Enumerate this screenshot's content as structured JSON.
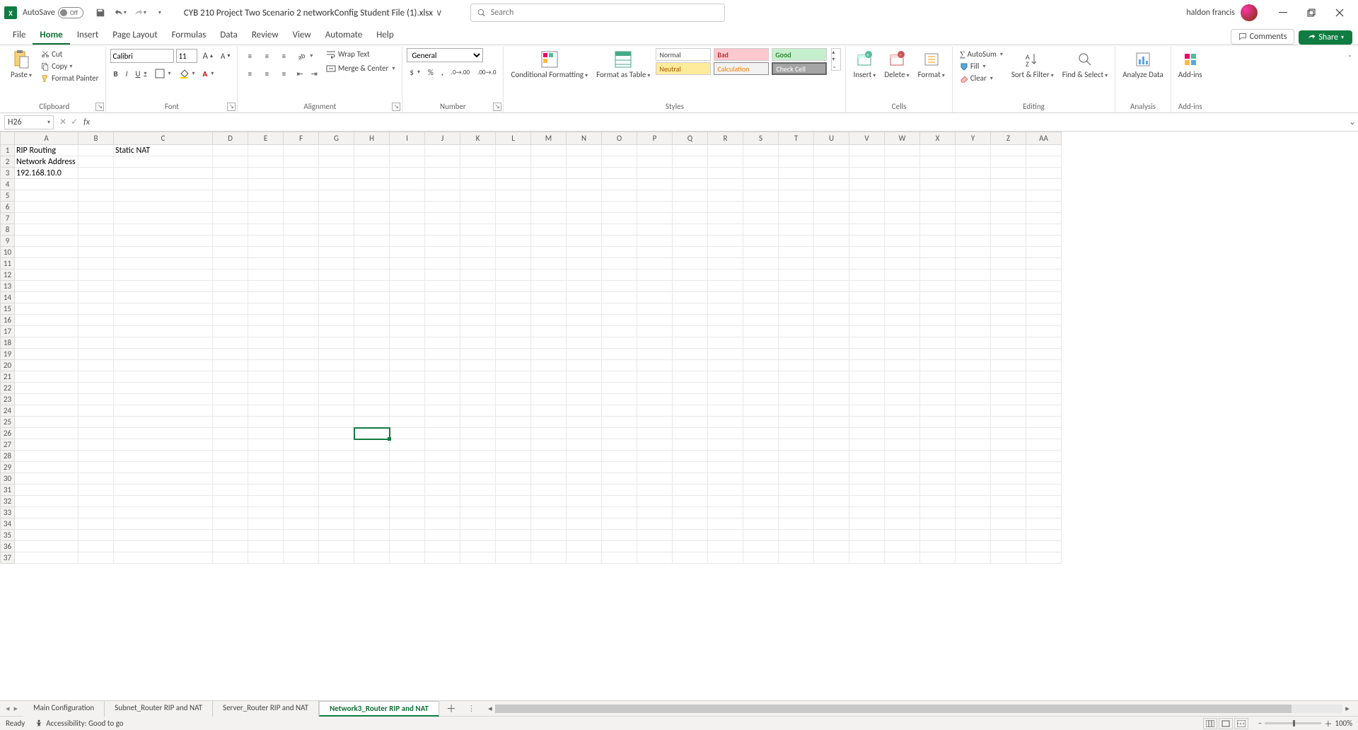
{
  "titlebar": {
    "autosave_label": "AutoSave",
    "autosave_state": "Off",
    "filename": "CYB 210 Project Two Scenario 2 networkConfig Student File (1).xlsx",
    "search_placeholder": "Search",
    "user": "haldon francis"
  },
  "tabs": {
    "items": [
      "File",
      "Home",
      "Insert",
      "Page Layout",
      "Formulas",
      "Data",
      "Review",
      "View",
      "Automate",
      "Help"
    ],
    "active": "Home",
    "comments": "Comments",
    "share": "Share"
  },
  "ribbon": {
    "clipboard": {
      "paste": "Paste",
      "cut": "Cut",
      "copy": "Copy",
      "painter": "Format Painter",
      "label": "Clipboard"
    },
    "font": {
      "name": "Calibri",
      "size": "11",
      "label": "Font"
    },
    "alignment": {
      "wrap": "Wrap Text",
      "merge": "Merge & Center",
      "label": "Alignment"
    },
    "number": {
      "format": "General",
      "label": "Number"
    },
    "styles": {
      "cond": "Conditional Formatting",
      "table": "Format as Table",
      "normal": "Normal",
      "bad": "Bad",
      "good": "Good",
      "neutral": "Neutral",
      "calc": "Calculation",
      "check": "Check Cell",
      "label": "Styles"
    },
    "cells": {
      "insert": "Insert",
      "delete": "Delete",
      "format": "Format",
      "label": "Cells"
    },
    "editing": {
      "autosum": "AutoSum",
      "fill": "Fill",
      "clear": "Clear",
      "sort": "Sort & Filter",
      "find": "Find & Select",
      "label": "Editing"
    },
    "analysis": {
      "analyze": "Analyze Data",
      "label": "Analysis"
    },
    "addins": {
      "addins": "Add-ins",
      "label": "Add-ins"
    }
  },
  "fbar": {
    "namebox": "H26",
    "formula": ""
  },
  "grid": {
    "cols": [
      "A",
      "B",
      "C",
      "D",
      "E",
      "F",
      "G",
      "H",
      "I",
      "J",
      "K",
      "L",
      "M",
      "N",
      "O",
      "P",
      "Q",
      "R",
      "S",
      "T",
      "U",
      "V",
      "W",
      "X",
      "Y",
      "Z",
      "AA"
    ],
    "col_widths": {
      "A": 90,
      "B": 50,
      "C": 140,
      "default": 50
    },
    "num_rows": 37,
    "cells": {
      "A1": "RIP Routing",
      "C1": "Static NAT",
      "A2": "Network Address",
      "A3": "192.168.10.0"
    },
    "selected": "H26"
  },
  "sheets": {
    "tabs": [
      "Main Configuration",
      "Subnet_Router RIP and NAT",
      "Server_Router RIP and NAT",
      "Network3_Router RIP and NAT"
    ],
    "active": "Network3_Router RIP and NAT"
  },
  "status": {
    "ready": "Ready",
    "access": "Accessibility: Good to go",
    "zoom": "100%"
  }
}
